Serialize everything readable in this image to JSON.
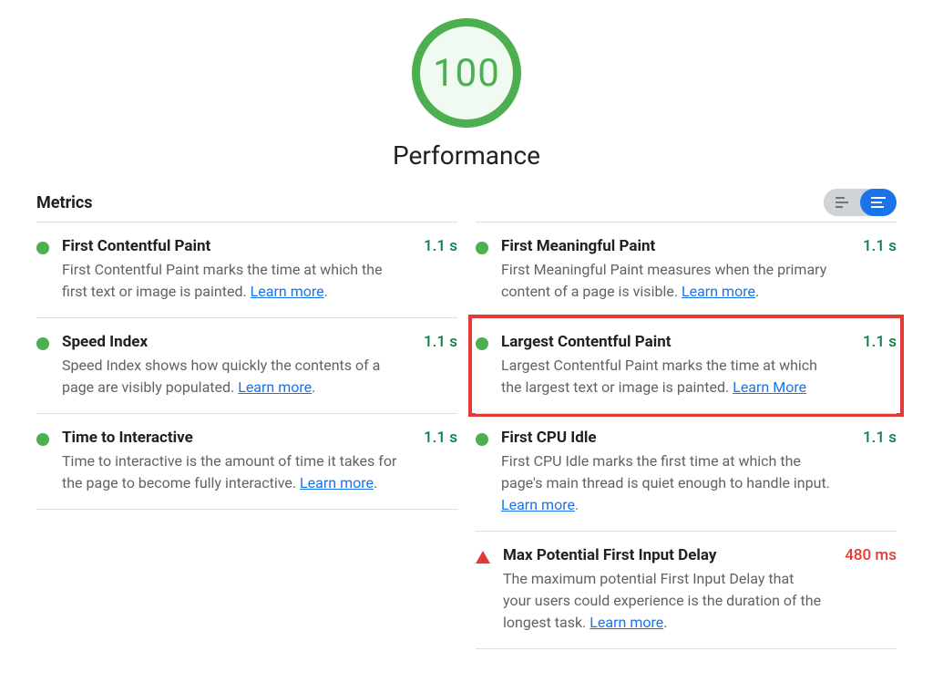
{
  "header": {
    "score": "100",
    "title": "Performance",
    "section_title": "Metrics"
  },
  "learn_label": "Learn more",
  "metrics": {
    "left": [
      {
        "name": "First Contentful Paint",
        "desc": "First Contentful Paint marks the time at which the first text or image is painted. ",
        "link": "Learn more",
        "value": "1.1 s",
        "status": "pass"
      },
      {
        "name": "Speed Index",
        "desc": "Speed Index shows how quickly the contents of a page are visibly populated. ",
        "link": "Learn more",
        "value": "1.1 s",
        "status": "pass"
      },
      {
        "name": "Time to Interactive",
        "desc": "Time to interactive is the amount of time it takes for the page to become fully interactive. ",
        "link": "Learn more",
        "value": "1.1 s",
        "status": "pass"
      }
    ],
    "right": [
      {
        "name": "First Meaningful Paint",
        "desc": "First Meaningful Paint measures when the primary content of a page is visible. ",
        "link": "Learn more",
        "value": "1.1 s",
        "status": "pass"
      },
      {
        "name": "Largest Contentful Paint",
        "desc": "Largest Contentful Paint marks the time at which the largest text or image is painted. ",
        "link": "Learn More",
        "value": "1.1 s",
        "status": "pass",
        "highlight": true
      },
      {
        "name": "First CPU Idle",
        "desc": "First CPU Idle marks the first time at which the page's main thread is quiet enough to handle input. ",
        "link": "Learn more",
        "value": "1.1 s",
        "status": "pass"
      },
      {
        "name": "Max Potential First Input Delay",
        "desc": "The maximum potential First Input Delay that your users could experience is the duration of the longest task. ",
        "link": "Learn more",
        "value": "480 ms",
        "status": "fail"
      }
    ]
  }
}
